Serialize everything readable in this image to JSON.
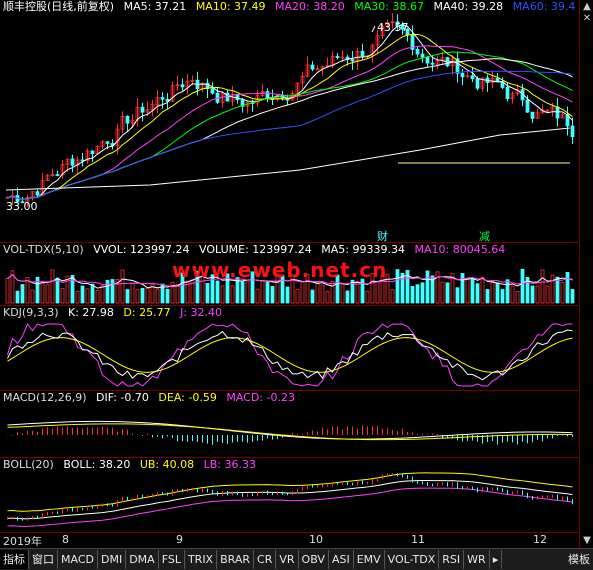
{
  "main": {
    "title": "顺丰控股(日线,前复权)",
    "ma": [
      {
        "label": "MA5: 37.21",
        "color": "#ffffff"
      },
      {
        "label": "MA10: 37.49",
        "color": "#ffff00"
      },
      {
        "label": "MA20: 38.20",
        "color": "#ff40ff"
      },
      {
        "label": "MA30: 38.67",
        "color": "#00ff00"
      },
      {
        "label": "MA40: 39.28",
        "color": "#ffffff"
      },
      {
        "label": "MA60: 39.4",
        "color": "#3050ff"
      }
    ],
    "high_label": "43.57",
    "low_label": "33.00",
    "markers": {
      "cai": "财",
      "jian": "减"
    }
  },
  "vol": {
    "items": [
      {
        "label": "VOL-TDX(5,10)",
        "color": "#dddddd"
      },
      {
        "label": "VVOL: 123997.24",
        "color": "#ffffff"
      },
      {
        "label": "VOLUME: 123997.24",
        "color": "#ffffff"
      },
      {
        "label": "MA5: 99339.34",
        "color": "#ffffff"
      },
      {
        "label": "MA10: 80045.64",
        "color": "#ff40ff"
      }
    ]
  },
  "kdj": {
    "items": [
      {
        "label": "KDJ(9,3,3)",
        "color": "#dddddd"
      },
      {
        "label": "K: 27.98",
        "color": "#ffffff"
      },
      {
        "label": "D: 25.77",
        "color": "#ffff00"
      },
      {
        "label": "J: 32.40",
        "color": "#ff40ff"
      }
    ]
  },
  "macd": {
    "items": [
      {
        "label": "MACD(12,26,9)",
        "color": "#dddddd"
      },
      {
        "label": "DIF: -0.70",
        "color": "#ffffff"
      },
      {
        "label": "DEA: -0.59",
        "color": "#ffff00"
      },
      {
        "label": "MACD: -0.23",
        "color": "#ff40ff"
      }
    ]
  },
  "boll": {
    "items": [
      {
        "label": "BOLL(20)",
        "color": "#dddddd"
      },
      {
        "label": "BOLL: 38.20",
        "color": "#ffffff"
      },
      {
        "label": "UB: 40.08",
        "color": "#ffff00"
      },
      {
        "label": "LB: 36.33",
        "color": "#ff40ff"
      }
    ]
  },
  "dates": [
    "2019年",
    "8",
    "9",
    "10",
    "11",
    "12"
  ],
  "watermark": "www.eweb.net.cn",
  "sidebar": {
    "up": "▲",
    "down": "▼",
    "close": "✕"
  },
  "bottombar": [
    "指标",
    "窗口",
    "MACD",
    "DMI",
    "DMA",
    "FSL",
    "TRIX",
    "BRAR",
    "CR",
    "VR",
    "OBV",
    "ASI",
    "EMV",
    "VOL-TDX",
    "RSI",
    "WR",
    "▸",
    "模板"
  ],
  "colors": {
    "up": "#ff3030",
    "down": "#40ffff",
    "grid": "#7a0000"
  }
}
